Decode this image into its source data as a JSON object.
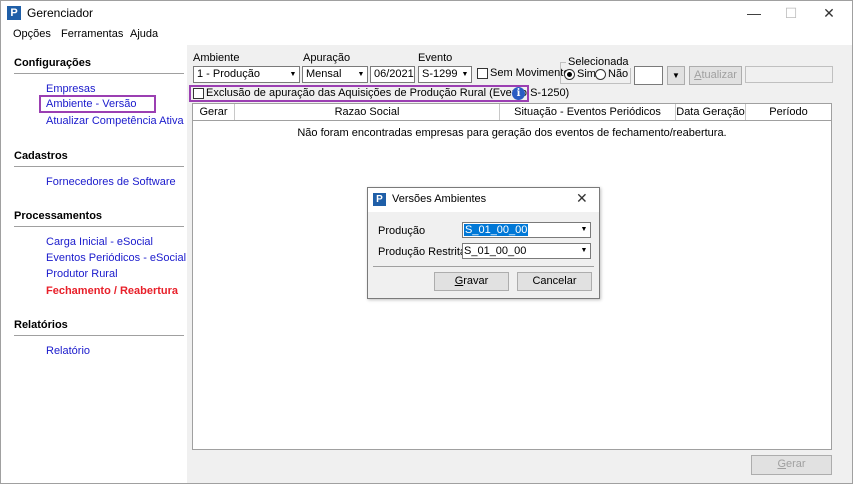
{
  "window": {
    "title": "Gerenciador",
    "minimize": "—",
    "maximize": "☐",
    "close": "✕"
  },
  "menu": [
    "Opções",
    "Ferramentas",
    "Ajuda"
  ],
  "sidebar": {
    "sections": [
      {
        "title": "Configurações",
        "items": [
          "Empresas",
          "Ambiente - Versão",
          "Atualizar Competência Ativa"
        ]
      },
      {
        "title": "Cadastros",
        "items": [
          "Fornecedores de Software"
        ]
      },
      {
        "title": "Processamentos",
        "items": [
          "Carga Inicial - eSocial",
          "Eventos Periódicos - eSocial",
          "Produtor Rural",
          "Fechamento / Reabertura"
        ]
      },
      {
        "title": "Relatórios",
        "items": [
          "Relatório"
        ]
      }
    ],
    "highlighted_item": "Ambiente - Versão",
    "active_item": "Fechamento / Reabertura"
  },
  "filters": {
    "ambiente_label": "Ambiente",
    "ambiente_value": "1 - Produção",
    "apuracao_label": "Apuração",
    "apuracao_value": "Mensal",
    "periodo_value": "06/2021",
    "evento_label": "Evento",
    "evento_value": "S-1299",
    "sem_movimento_label": "Sem Movimento",
    "selecionada_label": "Selecionada",
    "sim_label": "Sim",
    "nao_label": "Não",
    "atualizar_label": "Atualizar",
    "exclusao_label": "Exclusão de apuração das Aquisições de Produção Rural (Evento S-1250)",
    "info_icon_text": "i"
  },
  "grid": {
    "columns": [
      "Gerar",
      "Razao Social",
      "Situação - Eventos Periódicos",
      "Data Geração",
      "Período"
    ],
    "empty_message": "Não foram encontradas empresas para geração dos eventos de fechamento/reabertura."
  },
  "footer": {
    "gerar_label": "Gerar"
  },
  "dialog": {
    "title": "Versões Ambientes",
    "producao_label": "Produção",
    "producao_value": "S_01_00_00",
    "restrita_label": "Produção Restrita",
    "restrita_value": "S_01_00_00",
    "gravar_label": "Gravar",
    "cancelar_label": "Cancelar",
    "close": "✕"
  },
  "colors": {
    "link": "#1a1acc",
    "active_link": "#e8202a",
    "highlight_border": "#9b3fb2",
    "selection": "#0078d7"
  }
}
